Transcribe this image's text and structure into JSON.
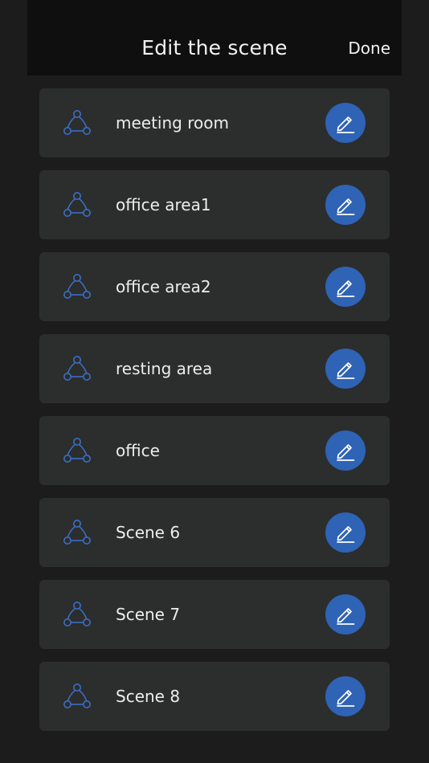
{
  "header": {
    "title": "Edit the scene",
    "done_label": "Done"
  },
  "scenes": [
    {
      "name": "meeting room"
    },
    {
      "name": "office area1"
    },
    {
      "name": "office area2"
    },
    {
      "name": "resting area"
    },
    {
      "name": "office"
    },
    {
      "name": "Scene 6"
    },
    {
      "name": "Scene 7"
    },
    {
      "name": "Scene 8"
    }
  ],
  "icons": {
    "scene": "scene-nodes-icon",
    "edit": "pencil-icon"
  },
  "colors": {
    "background": "#1b1c1b",
    "header_background": "#0f0f0f",
    "row_background": "#2c2d2d",
    "accent": "#2e63b5",
    "scene_icon": "#3a6fc4",
    "text": "#ededed"
  }
}
